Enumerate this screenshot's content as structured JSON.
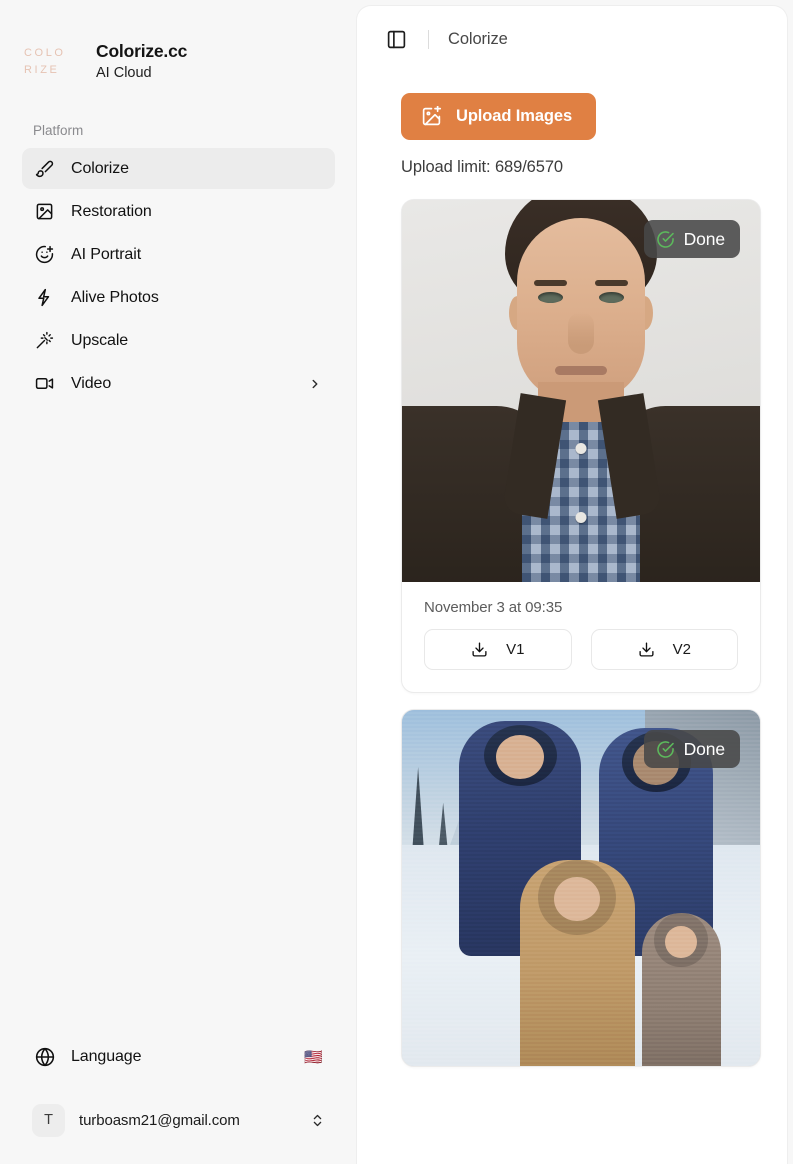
{
  "sidebar": {
    "brand": {
      "mark_line1": "COLO",
      "mark_line2": "RIZE",
      "title": "Colorize.cc",
      "subtitle": "AI Cloud",
      "mark_color": "#e6c3b3"
    },
    "section_label": "Platform",
    "items": [
      {
        "label": "Colorize",
        "icon": "paintbrush-icon",
        "active": true
      },
      {
        "label": "Restoration",
        "icon": "image-icon",
        "active": false
      },
      {
        "label": "AI Portrait",
        "icon": "smile-plus-icon",
        "active": false
      },
      {
        "label": "Alive Photos",
        "icon": "lightning-icon",
        "active": false
      },
      {
        "label": "Upscale",
        "icon": "magic-wand-icon",
        "active": false
      },
      {
        "label": "Video",
        "icon": "video-camera-icon",
        "active": false,
        "has_chevron": true
      }
    ],
    "language": {
      "label": "Language",
      "flag": "🇺🇸",
      "icon": "globe-icon"
    },
    "account": {
      "avatar_initial": "T",
      "email": "turboasm21@gmail.com",
      "icon": "chevrons-up-down-icon"
    }
  },
  "topbar": {
    "toggle_icon": "panel-left-icon",
    "title": "Colorize"
  },
  "main": {
    "upload_button": {
      "label": "Upload Images",
      "icon": "image-plus-icon",
      "color": "#e08043"
    },
    "upload_limit": "Upload limit: 689/6570",
    "cards": [
      {
        "status": "Done",
        "status_icon": "check-circle-icon",
        "date": "November 3 at 09:35",
        "downloads": [
          {
            "label": "V1",
            "icon": "download-icon"
          },
          {
            "label": "V2",
            "icon": "download-icon"
          }
        ]
      },
      {
        "status": "Done",
        "status_icon": "check-circle-icon"
      }
    ]
  }
}
